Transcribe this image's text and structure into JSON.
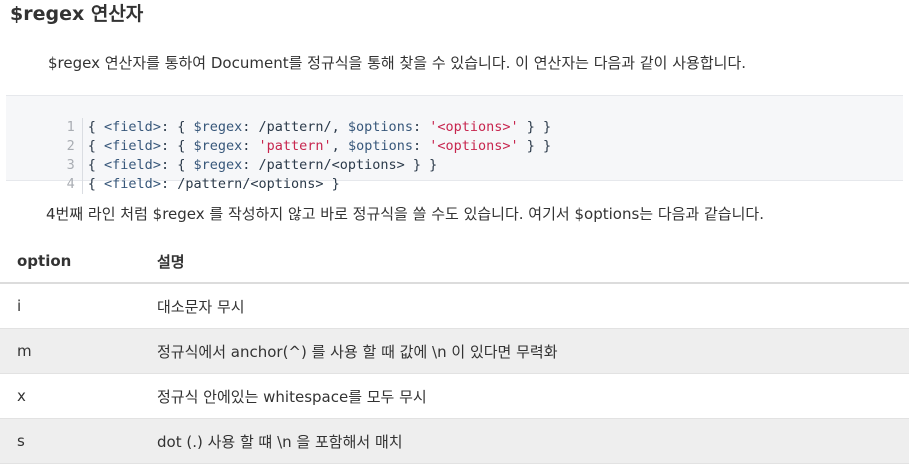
{
  "heading": "$regex 연산자",
  "intro": "$regex 연산자를 통하여 Document를 정규식을 통해 찾을 수 있습니다. 이 연산자는 다음과 같이 사용합니다.",
  "code": {
    "lines": [
      {
        "num": "1",
        "text": "{ <field>: { $regex: /pattern/, $options: '<options>' } }"
      },
      {
        "num": "2",
        "text": "{ <field>: { $regex: 'pattern', $options: '<options>' } }"
      },
      {
        "num": "3",
        "text": "{ <field>: { $regex: /pattern/<options> } }"
      },
      {
        "num": "4",
        "text": "{ <field>: /pattern/<options> }"
      }
    ]
  },
  "note": "4번째 라인 처럼 $regex 를 작성하지 않고 바로 정규식을 쓸 수도 있습니다. 여기서 $options는 다음과 같습니다.",
  "table": {
    "headers": [
      "option",
      "설명"
    ],
    "rows": [
      {
        "option": "i",
        "desc": "대소문자 무시"
      },
      {
        "option": "m",
        "desc": "정규식에서 anchor(^) 를 사용 할 때 값에 \\n 이 있다면 무력화"
      },
      {
        "option": "x",
        "desc": "정규식 안에있는 whitespace를 모두 무시"
      },
      {
        "option": "s",
        "desc": "dot (.) 사용 할 떄 \\n 을 포함해서 매치"
      }
    ]
  },
  "colors": {
    "text": "#333333",
    "code_bg": "#f6f7f9",
    "string": "#c7254e",
    "stripe": "#eeeeee"
  }
}
